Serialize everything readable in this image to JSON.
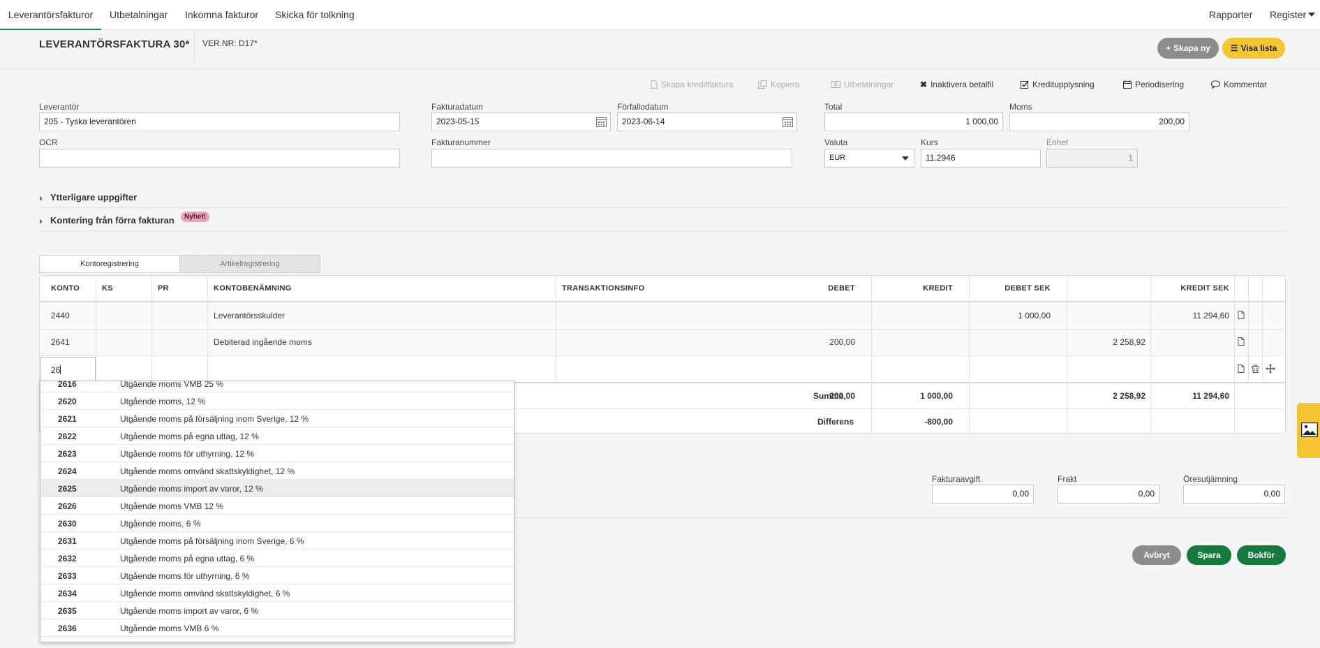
{
  "nav": {
    "tabs": [
      "Leverantörsfakturor",
      "Utbetalningar",
      "Inkomna fakturor",
      "Skicka för tolkning"
    ],
    "right": [
      "Rapporter",
      "Register"
    ]
  },
  "header": {
    "title": "LEVERANTÖRSFAKTURA 30*",
    "vernr": "VER.NR: D17*",
    "btn_new": "Skapa ny",
    "btn_list": "Visa lista"
  },
  "toolbar": {
    "credit_invoice": "Skapa kreditfaktura",
    "copy": "Kopiera",
    "payments": "Utbetalningar",
    "deactivate": "Inaktivera betalfil",
    "credit_info": "Kreditupplysning",
    "accrual": "Periodisering",
    "comment": "Kommentar"
  },
  "form": {
    "supplier_label": "Leverantör",
    "supplier_value": "205 - Tyska leverantören",
    "ocr_label": "OCR",
    "ocr_value": "",
    "invoice_date_label": "Fakturadatum",
    "invoice_date_value": "2023-05-15",
    "due_date_label": "Förfallodatum",
    "due_date_value": "2023-06-14",
    "invoice_number_label": "Fakturanummer",
    "invoice_number_value": "",
    "total_label": "Total",
    "total_value": "1 000,00",
    "vat_label": "Moms",
    "vat_value": "200,00",
    "currency_label": "Valuta",
    "currency_value": "EUR",
    "rate_label": "Kurs",
    "rate_value": "11.2946",
    "unit_label": "Enhet",
    "unit_value": "1"
  },
  "sections": {
    "additional": "Ytterligare uppgifter",
    "previous": "Kontering från förra fakturan",
    "new_badge": "Nyhet!"
  },
  "reg_tabs": {
    "account": "Kontoregistrering",
    "article": "Artikelregistrering"
  },
  "table": {
    "headers": {
      "konto": "KONTO",
      "ks": "KS",
      "pr": "PR",
      "name": "KONTOBENÄMNING",
      "info": "TRANSAKTIONSINFO",
      "debet": "DEBET",
      "kredit": "KREDIT",
      "debet_sek": "DEBET SEK",
      "kredit_sek": "KREDIT SEK"
    },
    "rows": [
      {
        "konto": "2440",
        "name": "Leverantörsskulder",
        "debet": "",
        "kredit": "1 000,00",
        "debet_sek": "",
        "kredit_sek": "11 294,60"
      },
      {
        "konto": "2641",
        "name": "Debiterad ingående moms",
        "debet": "200,00",
        "kredit": "",
        "debet_sek": "2 258,92",
        "kredit_sek": ""
      }
    ],
    "input_value": "26",
    "summa_label": "Summa",
    "summa": {
      "debet": "200,00",
      "kredit": "1 000,00",
      "debet_sek": "2 258,92",
      "kredit_sek": "11 294,60"
    },
    "diff_label": "Differens",
    "diff_value": "-800,00"
  },
  "dropdown": {
    "items": [
      {
        "code": "2616",
        "name": "Utgående moms VMB 25 %"
      },
      {
        "code": "2620",
        "name": "Utgående moms, 12 %"
      },
      {
        "code": "2621",
        "name": "Utgående moms på försäljning inom Sverige, 12 %"
      },
      {
        "code": "2622",
        "name": "Utgående moms på egna uttag, 12 %"
      },
      {
        "code": "2623",
        "name": "Utgående moms för uthyrning, 12 %"
      },
      {
        "code": "2624",
        "name": "Utgående moms omvänd skattskyldighet, 12 %"
      },
      {
        "code": "2625",
        "name": "Utgående moms import av varor, 12 %"
      },
      {
        "code": "2626",
        "name": "Utgående moms VMB 12 %"
      },
      {
        "code": "2630",
        "name": "Utgående moms, 6 %"
      },
      {
        "code": "2631",
        "name": "Utgående moms på försäljning inom Sverige, 6 %"
      },
      {
        "code": "2632",
        "name": "Utgående moms på egna uttag, 6 %"
      },
      {
        "code": "2633",
        "name": "Utgående moms för uthyrning, 6 %"
      },
      {
        "code": "2634",
        "name": "Utgående moms omvänd skattskyldighet, 6 %"
      },
      {
        "code": "2635",
        "name": "Utgående moms import av varor, 6 %"
      },
      {
        "code": "2636",
        "name": "Utgående moms VMB 6 %"
      }
    ]
  },
  "bottom": {
    "fee_label": "Fakturaavgift",
    "fee_value": "0,00",
    "freight_label": "Frakt",
    "freight_value": "0,00",
    "rounding_label": "Öresutjämning",
    "rounding_value": "0,00",
    "cancel": "Avbryt",
    "save": "Spara",
    "post": "Bokför"
  },
  "colors": {
    "accent_green": "#157a3d",
    "accent_yellow": "#f6c533",
    "badge_pink": "#f49bb6"
  }
}
